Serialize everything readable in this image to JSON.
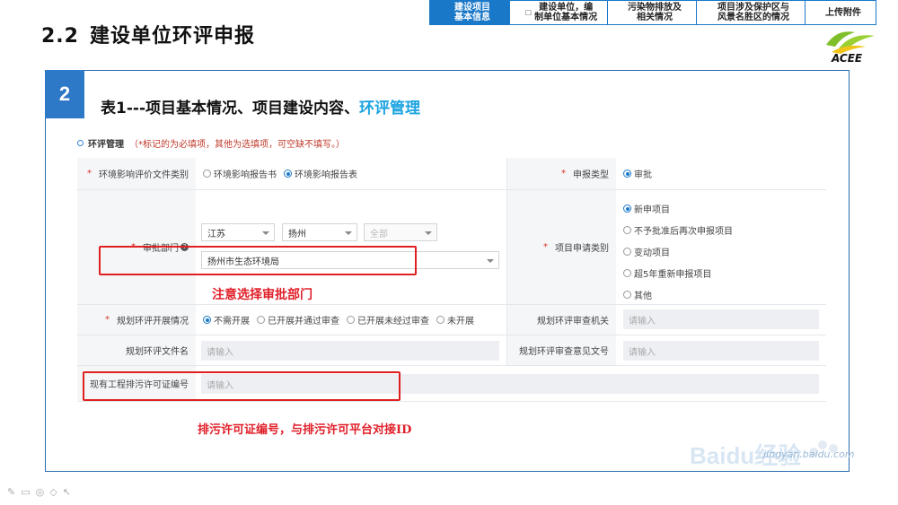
{
  "slide": {
    "number": "2.2",
    "title": "建设单位环评申报"
  },
  "steps": [
    {
      "line1": "建设项目",
      "line2": "基本信息",
      "active": true
    },
    {
      "line1": "建设单位，编",
      "line2": "制单位基本情况",
      "active": false
    },
    {
      "line1": "污染物排放及",
      "line2": "相关情况",
      "active": false
    },
    {
      "line1": "项目涉及保护区与",
      "line2": "风景名胜区的情况",
      "active": false
    },
    {
      "line1": "上传附件",
      "line2": "",
      "active": false
    }
  ],
  "logo": {
    "text": "ACEE"
  },
  "panel": {
    "badge": "2",
    "title": "表1---项目基本情况、项目建设内容、",
    "title_highlight": "环评管理"
  },
  "section": {
    "name": "环评管理",
    "hint": "（*标记的为必填项，其他为选填项，可空缺不填写。）"
  },
  "form": {
    "doc_type": {
      "label": "环境影响评价文件类别",
      "options": [
        "环境影响报告书",
        "环境影响报告表"
      ],
      "selected": 1
    },
    "report_type": {
      "label": "申报类型",
      "options": [
        "审批"
      ],
      "selected": 0
    },
    "approval_dept": {
      "label": "审批部门",
      "province": "江苏",
      "city": "扬州",
      "district": "全部",
      "dept": "扬州市生态环境局"
    },
    "apply_category": {
      "label": "项目申请类别",
      "options": [
        "新申项目",
        "不予批准后再次申报项目",
        "变动项目",
        "超5年重新申报项目",
        "其他"
      ],
      "selected": 0
    },
    "plan_eia_status": {
      "label": "规划环评开展情况",
      "options": [
        "不需开展",
        "已开展并通过审查",
        "已开展未经过审查",
        "未开展"
      ],
      "selected": 0
    },
    "plan_review_org": {
      "label": "规划环评审查机关",
      "placeholder": "请输入"
    },
    "plan_eia_file": {
      "label": "规划环评文件名",
      "placeholder": "请输入"
    },
    "plan_review_doc": {
      "label": "规划环评审查意见文号",
      "placeholder": "请输入"
    },
    "permit_no": {
      "label": "现有工程排污许可证编号",
      "placeholder": "请输入"
    }
  },
  "annotations": {
    "dept_note": "注意选择审批部门",
    "permit_note": "排污许可证编号，与排污许可平台对接ID"
  },
  "watermark": {
    "brand": "Baidu经验",
    "url": "jingyan.baidu.com"
  }
}
